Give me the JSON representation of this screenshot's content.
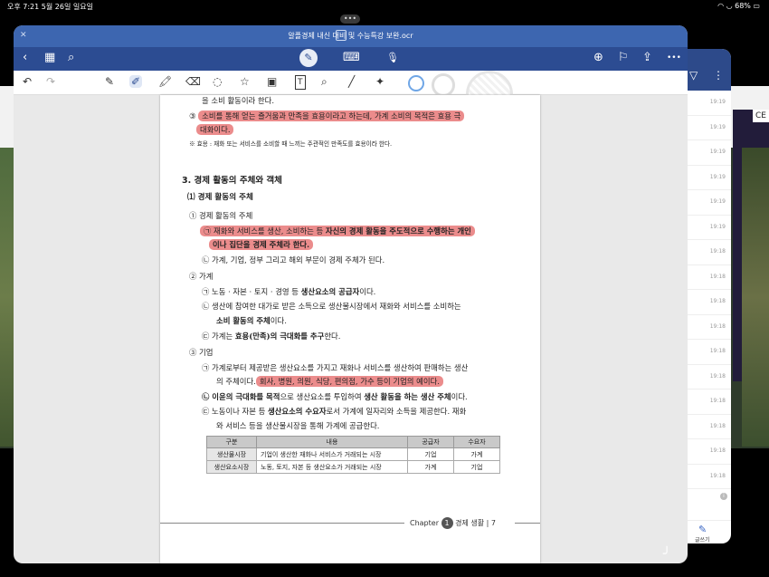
{
  "status": {
    "time_date": "오후 7:21  5월 26일 일요일",
    "battery": "68%"
  },
  "multitask": "•••",
  "background_app": {
    "partial_text": "CE"
  },
  "side_panel": {
    "times": [
      "19:19",
      "19:19",
      "19:19",
      "19:19",
      "19:19",
      "19:19",
      "19:18",
      "19:18",
      "19:18",
      "19:18",
      "19:18",
      "19:18",
      "19:18",
      "19:18",
      "19:18",
      "19:18"
    ],
    "bottom_label": "글쓰기"
  },
  "window": {
    "title": "알플경제 내신 대비 및 수능특강 보완.ocr",
    "nav": {
      "back": "‹",
      "grid": "▦",
      "search": "⌕",
      "keyboard": "⌨",
      "mic": "🎙",
      "add_page": "⊕",
      "bookmark": "⚐",
      "share": "⇪",
      "more": "•••"
    },
    "toolbar": [
      "↶",
      "↷",
      "✎",
      "✐",
      "🖍",
      "⌫",
      "◌",
      "☆",
      "▣",
      "T",
      "⌕",
      "╱",
      "✦"
    ]
  },
  "doc": {
    "l1": "을 소비 활동이라 한다.",
    "l2a": "③ ",
    "l2b": "소비를 통해 얻는 즐거움과 만족을 효용이라고 하는데, 가계 소비의 목적은 효용 극",
    "l3": "대화이다.",
    "l4": "※ 효용 : 재화 또는 서비스를 소비할 때 느끼는 주관적인 만족도를 효용이라 한다.",
    "h3": "3. 경제 활동의 주체와 객체",
    "h31": "⑴ 경제 활동의 주체",
    "c1": "① 경제 활동의 주체",
    "c1a_pre": "㉠ 재화와 서비스를 생산, 소비하는 등 ",
    "c1a_bold": "자신의 경제 활동을 주도적으로 수행하는 개인",
    "c1a2": "이나 집단을 경제 주체라 한다.",
    "c1b": "㉡ 가계, 기업, 정부 그리고 해외 부문이 경제 주체가 된다.",
    "c2": "② 가계",
    "c2a_pre": "㉠ 노동 · 자본 · 토지 · 경영 등 ",
    "c2a_bold": "생산요소의 공급자",
    "c2a_post": "이다.",
    "c2b": "㉡ 생산에 참여한 대가로 받은 소득으로 생산물시장에서 재화와 서비스를 소비하는",
    "c2b2_bold": "소비 활동의 주체",
    "c2b2_post": "이다.",
    "c2c_pre": "㉢ 가계는 ",
    "c2c_bold": "효용(만족)의 극대화를 추구",
    "c2c_post": "한다.",
    "c3": "③ 기업",
    "c3a": "㉠ 가계로부터 제공받은 생산요소를 가지고 재화나 서비스를 생산하여 판매하는 생산",
    "c3a2_pre": "의 주체이다.",
    "c3a2_hl": "회사, 병원, 의원, 식당, 편의점, 가수 등이 기업의 예이다.",
    "c3b_bold": "㉡ 이윤의 극대화를 목적",
    "c3b_mid": "으로 생산요소를 투입하여 ",
    "c3b_bold2": "생산 활동을 하는 생산 주체",
    "c3b_post": "이다.",
    "c3c_pre": "㉢ 노동이나 자본 등 ",
    "c3c_bold": "생산요소의 수요자",
    "c3c_post": "로서 가계에 일자리와 소득을 제공한다. 재화",
    "c3c2": "와 서비스 등을 생산물시장을 통해 가계에 공급한다.",
    "table": {
      "headers": [
        "구분",
        "내용",
        "공급자",
        "수요자"
      ],
      "rows": [
        [
          "생산물시장",
          "기업이 생산한 재화나 서비스가 거래되는 시장",
          "기업",
          "가계"
        ],
        [
          "생산요소시장",
          "노동, 토지, 자본 등 생산요소가 거래되는 시장",
          "가계",
          "기업"
        ]
      ]
    },
    "footer": {
      "chapter": "Chapter",
      "num": "1",
      "title": "경제 생활",
      "page": "| 7"
    }
  },
  "colors": {
    "highlight": "#eb8c8c",
    "nav": "#2c4c92",
    "titlebar": "#3d66b0"
  }
}
